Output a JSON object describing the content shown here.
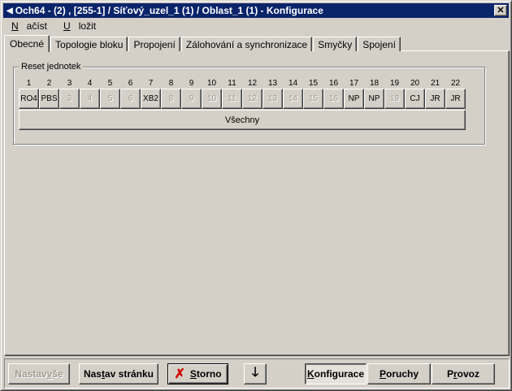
{
  "window": {
    "title": "Och64 - (2) , [255-1] / Síťový_uzel_1 (1) / Oblast_1 (1) - Konfigurace",
    "icon": "back-arrow-icon",
    "close_label": "✕"
  },
  "menu": {
    "nacist": {
      "first": "N",
      "rest": "ačíst"
    },
    "ulozit": {
      "first": "U",
      "rest": "ložit"
    }
  },
  "tabs": [
    {
      "label": "Obecné",
      "active": true
    },
    {
      "label": "Topologie bloku",
      "active": false
    },
    {
      "label": "Propojení",
      "active": false
    },
    {
      "label": "Zálohování a synchronizace",
      "active": false
    },
    {
      "label": "Smyčky",
      "active": false
    },
    {
      "label": "Spojení",
      "active": false
    }
  ],
  "reset_group": {
    "label": "Reset jednotek",
    "numbers": [
      "1",
      "2",
      "3",
      "4",
      "5",
      "6",
      "7",
      "8",
      "9",
      "10",
      "11",
      "12",
      "13",
      "14",
      "15",
      "16",
      "17",
      "18",
      "19",
      "20",
      "21",
      "22"
    ],
    "units": [
      {
        "label": "RO4",
        "enabled": true
      },
      {
        "label": "PBS",
        "enabled": true
      },
      {
        "label": "3",
        "enabled": false
      },
      {
        "label": "4",
        "enabled": false
      },
      {
        "label": "5",
        "enabled": false
      },
      {
        "label": "6",
        "enabled": false
      },
      {
        "label": "XB2",
        "enabled": true
      },
      {
        "label": "8",
        "enabled": false
      },
      {
        "label": "9",
        "enabled": false
      },
      {
        "label": "10",
        "enabled": false
      },
      {
        "label": "11",
        "enabled": false
      },
      {
        "label": "12",
        "enabled": false
      },
      {
        "label": "13",
        "enabled": false
      },
      {
        "label": "14",
        "enabled": false
      },
      {
        "label": "15",
        "enabled": false
      },
      {
        "label": "16",
        "enabled": false
      },
      {
        "label": "NP",
        "enabled": true
      },
      {
        "label": "NP",
        "enabled": true
      },
      {
        "label": "19",
        "enabled": false
      },
      {
        "label": "CJ",
        "enabled": true
      },
      {
        "label": "JR",
        "enabled": true
      },
      {
        "label": "JR",
        "enabled": true
      }
    ],
    "all_label": "Všechny"
  },
  "bottom": {
    "nastav_vse": {
      "pre": "Nastav ",
      "u": "v",
      "post": "še"
    },
    "nastav_stranku": {
      "pre": "Nas",
      "u": "t",
      "post": "av stránku"
    },
    "storno": {
      "pre": "",
      "u": "S",
      "post": "torno"
    },
    "down_arrow": "🡓",
    "konfigurace": {
      "pre": "",
      "u": "K",
      "post": "onfigurace"
    },
    "poruchy": {
      "pre": "",
      "u": "P",
      "post": "oruchy"
    },
    "provoz": {
      "pre": "P",
      "u": "r",
      "post": "ovoz"
    }
  }
}
